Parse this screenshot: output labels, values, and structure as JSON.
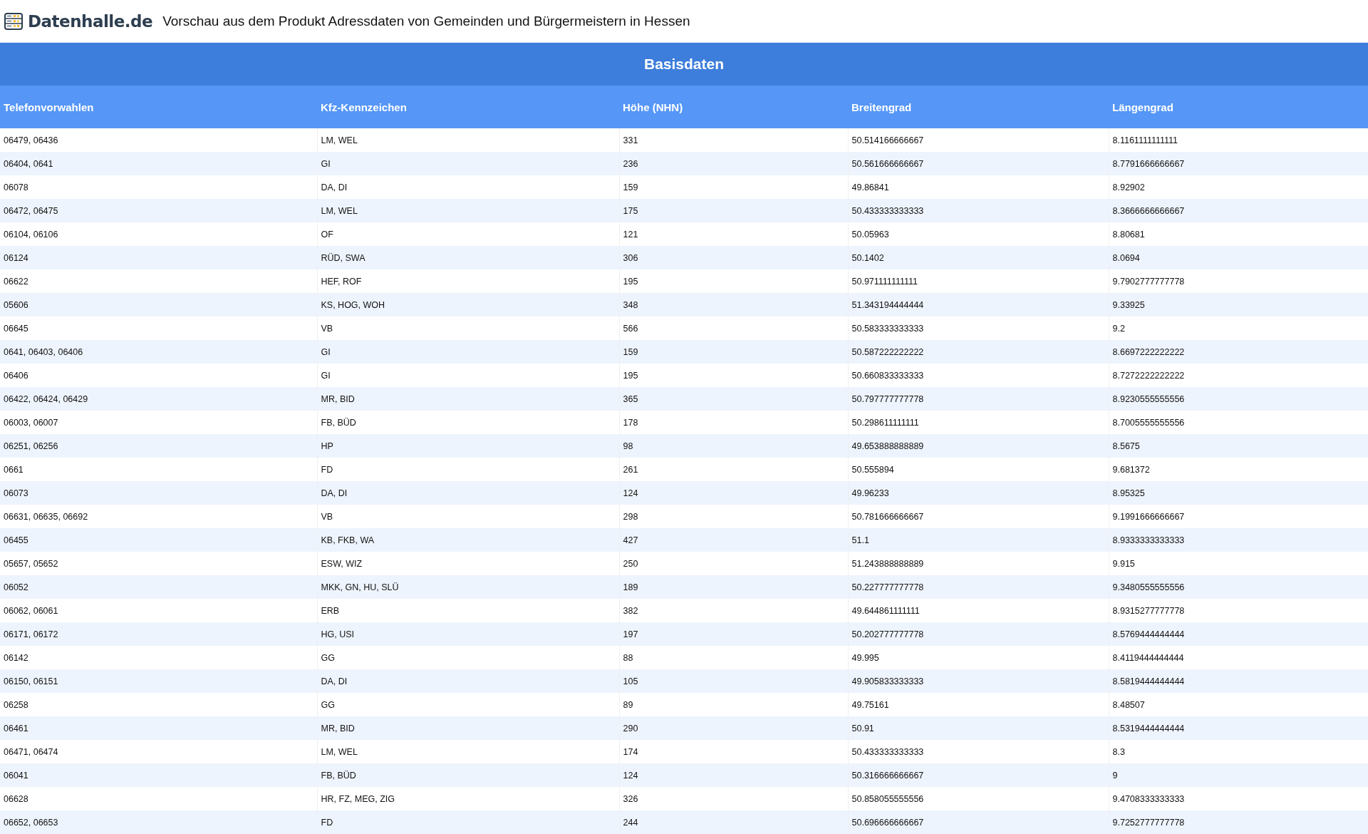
{
  "header": {
    "logo": "Datenhalle.de",
    "title": "Vorschau aus dem Produkt Adressdaten von Gemeinden und Bürgermeistern in Hessen"
  },
  "table": {
    "caption": "Basisdaten",
    "columns": [
      "Telefonvorwahlen",
      "Kfz-Kennzeichen",
      "Höhe (NHN)",
      "Breitengrad",
      "Längengrad"
    ],
    "rows": [
      [
        "06479, 06436",
        "LM, WEL",
        "331",
        "50.514166666667",
        "8.1161111111111"
      ],
      [
        "06404, 0641",
        "GI",
        "236",
        "50.561666666667",
        "8.7791666666667"
      ],
      [
        "06078",
        "DA, DI",
        "159",
        "49.86841",
        "8.92902"
      ],
      [
        "06472, 06475",
        "LM, WEL",
        "175",
        "50.433333333333",
        "8.3666666666667"
      ],
      [
        "06104, 06106",
        "OF",
        "121",
        "50.05963",
        "8.80681"
      ],
      [
        "06124",
        "RÜD, SWA",
        "306",
        "50.1402",
        "8.0694"
      ],
      [
        "06622",
        "HEF, ROF",
        "195",
        "50.971111111111",
        "9.7902777777778"
      ],
      [
        "05606",
        "KS, HOG, WOH",
        "348",
        "51.343194444444",
        "9.33925"
      ],
      [
        "06645",
        "VB",
        "566",
        "50.583333333333",
        "9.2"
      ],
      [
        "0641, 06403, 06406",
        "GI",
        "159",
        "50.587222222222",
        "8.6697222222222"
      ],
      [
        "06406",
        "GI",
        "195",
        "50.660833333333",
        "8.7272222222222"
      ],
      [
        "06422, 06424, 06429",
        "MR, BID",
        "365",
        "50.797777777778",
        "8.9230555555556"
      ],
      [
        "06003, 06007",
        "FB, BÜD",
        "178",
        "50.298611111111",
        "8.7005555555556"
      ],
      [
        "06251, 06256",
        "HP",
        "98",
        "49.653888888889",
        "8.5675"
      ],
      [
        "0661",
        "FD",
        "261",
        "50.555894",
        "9.681372"
      ],
      [
        "06073",
        "DA, DI",
        "124",
        "49.96233",
        "8.95325"
      ],
      [
        "06631, 06635, 06692",
        "VB",
        "298",
        "50.781666666667",
        "9.1991666666667"
      ],
      [
        "06455",
        "KB, FKB, WA",
        "427",
        "51.1",
        "8.9333333333333"
      ],
      [
        "05657, 05652",
        "ESW, WIZ",
        "250",
        "51.243888888889",
        "9.915"
      ],
      [
        "06052",
        "MKK, GN, HU, SLÜ",
        "189",
        "50.227777777778",
        "9.3480555555556"
      ],
      [
        "06062, 06061",
        "ERB",
        "382",
        "49.644861111111",
        "8.9315277777778"
      ],
      [
        "06171, 06172",
        "HG, USI",
        "197",
        "50.202777777778",
        "8.5769444444444"
      ],
      [
        "06142",
        "GG",
        "88",
        "49.995",
        "8.4119444444444"
      ],
      [
        "06150, 06151",
        "DA, DI",
        "105",
        "49.905833333333",
        "8.5819444444444"
      ],
      [
        "06258",
        "GG",
        "89",
        "49.75161",
        "8.48507"
      ],
      [
        "06461",
        "MR, BID",
        "290",
        "50.91",
        "8.5319444444444"
      ],
      [
        "06471, 06474",
        "LM, WEL",
        "174",
        "50.433333333333",
        "8.3"
      ],
      [
        "06041",
        "FB, BÜD",
        "124",
        "50.316666666667",
        "9"
      ],
      [
        "06628",
        "HR, FZ, MEG, ZIG",
        "326",
        "50.858055555556",
        "9.4708333333333"
      ],
      [
        "06652, 06653",
        "FD",
        "244",
        "50.696666666667",
        "9.7252777777778"
      ]
    ]
  }
}
